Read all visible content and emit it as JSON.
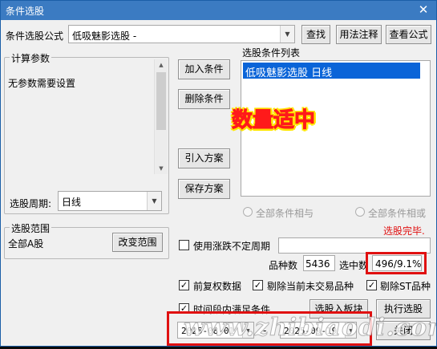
{
  "window": {
    "title": "条件选股",
    "close_glyph": "✕"
  },
  "formula": {
    "label": "条件选股公式",
    "value": "低吸魅影选股  -",
    "buttons": {
      "find": "查找",
      "usage": "用法注释",
      "view": "查看公式"
    }
  },
  "params": {
    "title": "计算参数",
    "text": "无参数需要设置",
    "period_label": "选股周期:",
    "period_value": "日线"
  },
  "actions": {
    "add": "加入条件",
    "delete": "删除条件",
    "import": "引入方案",
    "save": "保存方案"
  },
  "conditions": {
    "title": "选股条件列表",
    "items": [
      "低吸魅影选股  日线"
    ],
    "annotation": "数量适中",
    "annotation_color": "#ff1a1a",
    "annotation_fill": "#ffe600"
  },
  "logic": {
    "and_label": "全部条件相与",
    "or_label": "全部条件相或"
  },
  "status": {
    "text": "选股完毕.",
    "color": "#e01010"
  },
  "scope": {
    "title": "选股范围",
    "value": "全部A股",
    "change_button": "改变范围"
  },
  "stats": {
    "use_volatile_label": "使用涨跌不定周期",
    "count_label": "品种数",
    "count_value": "5436",
    "selected_label": "选中数",
    "selected_value": "496/9.1%"
  },
  "options": {
    "pre_adjust": "前复权数据",
    "exclude_untraded": "剔除当前未交易品种",
    "exclude_st": "剔除ST品种",
    "period_satisfy": "时间段内满足条件"
  },
  "bottom": {
    "to_block": "选股入板块",
    "execute": "执行选股",
    "close": "关闭",
    "date_from": "2025-08-01",
    "date_separator": "-",
    "date_to": "2025-09-19"
  },
  "watermark": "www.zhibiaodi.com",
  "highlight_color": "#e01010"
}
